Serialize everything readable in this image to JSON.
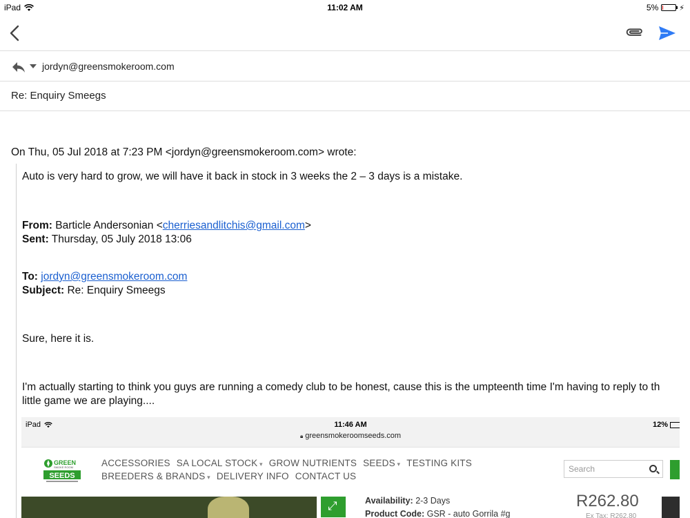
{
  "status_bar": {
    "device": "iPad",
    "time": "11:02 AM",
    "battery": "5%",
    "battery_level": 0.05
  },
  "email": {
    "from_address": "jordyn@greensmokeroom.com",
    "subject": "Re: Enquiry Smeegs",
    "wrote_line": "On Thu, 05 Jul 2018 at 7:23 PM <jordyn@greensmokeroom.com> wrote:",
    "reply_text": "Auto is very hard to grow, we will have it back in stock in 3 weeks the 2 – 3 days is a mistake.",
    "header": {
      "from_label": "From:",
      "from_name": "Barticle Andersonian <",
      "from_email": "cherriesandlitchis@gmail.com",
      "from_close": ">",
      "sent_label": "Sent:",
      "sent_value": "Thursday, 05 July 2018 13:06",
      "to_label": "To:",
      "to_email": "jordyn@greensmokeroom.com",
      "subject_label": "Subject:",
      "subject_value": "Re: Enquiry Smeegs"
    },
    "sure_line": "Sure, here it is.",
    "para_line1": "I'm actually starting to think you guys are running a comedy club to be honest, cause this is the umpteenth time I'm having to reply to th",
    "para_line2": "little game we are playing...."
  },
  "embedded_screenshot": {
    "device": "iPad",
    "time": "11:46 AM",
    "battery": "12%",
    "url": "greensmokeroomseeds.com",
    "logo_line1": "GREEN",
    "logo_line2": "SEEDS",
    "menu_row1": [
      "ACCESSORIES",
      "SA LOCAL STOCK",
      "GROW NUTRIENTS",
      "SEEDS",
      "TESTING KITS"
    ],
    "menu_row2": [
      "BREEDERS & BRANDS",
      "DELIVERY INFO",
      "CONTACT US"
    ],
    "search_placeholder": "Search",
    "availability_label": "Availability:",
    "availability_value": "2-3 Days",
    "product_code_label": "Product Code:",
    "product_code_value": "GSR - auto Gorrila #g",
    "price": "R262.80",
    "ex_tax": "Ex Tax: R262.80"
  },
  "colors": {
    "link": "#1a5fd0",
    "send_icon": "#2f7bf5",
    "brand_green": "#2e9e2e"
  }
}
